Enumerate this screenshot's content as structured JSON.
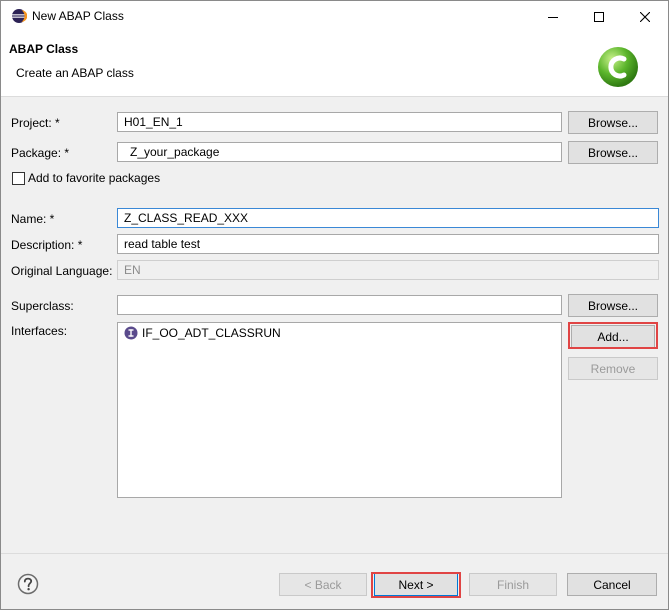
{
  "window": {
    "title": "New ABAP Class"
  },
  "header": {
    "title": "ABAP Class",
    "subtitle": "Create an ABAP class"
  },
  "form": {
    "project": {
      "label": "Project: *",
      "value": "H01_EN_1",
      "button": "Browse..."
    },
    "package": {
      "label": "Package: *",
      "value": "Z_your_package",
      "button": "Browse..."
    },
    "favorite": {
      "label": "Add to favorite packages",
      "checked": false
    },
    "name": {
      "label": "Name: *",
      "value": "Z_CLASS_READ_XXX"
    },
    "description": {
      "label": "Description: *",
      "value": "read table test"
    },
    "language": {
      "label": "Original Language:",
      "value": "EN"
    },
    "superclass": {
      "label": "Superclass:",
      "value": "",
      "button": "Browse..."
    },
    "interfaces": {
      "label": "Interfaces:",
      "items": [
        "IF_OO_ADT_CLASSRUN"
      ],
      "add_button": "Add...",
      "remove_button": "Remove"
    }
  },
  "footer": {
    "back": "< Back",
    "next": "Next >",
    "finish": "Finish",
    "cancel": "Cancel"
  },
  "icons": {
    "title": "eclipse-icon",
    "logo": "abap-class-logo",
    "interface": "interface-icon",
    "help": "help-icon"
  },
  "colors": {
    "highlight": "#e04444",
    "focus": "#3a88d6",
    "logo_green": "#5bb52b"
  }
}
